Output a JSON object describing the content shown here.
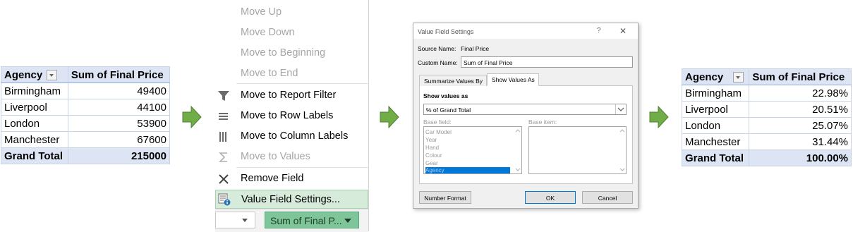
{
  "table1": {
    "header": {
      "agency": "Agency",
      "value": "Sum of Final Price"
    },
    "rows": [
      {
        "agency": "Birmingham",
        "value": "49400"
      },
      {
        "agency": "Liverpool",
        "value": "44100"
      },
      {
        "agency": "London",
        "value": "53900"
      },
      {
        "agency": "Manchester",
        "value": "67600"
      }
    ],
    "total": {
      "label": "Grand Total",
      "value": "215000"
    }
  },
  "arrows": {
    "color": "#70ad47"
  },
  "menu": {
    "items": [
      {
        "label": "Move Up",
        "icon": "none",
        "enabled": false
      },
      {
        "label": "Move Down",
        "icon": "none",
        "enabled": false
      },
      {
        "label": "Move to Beginning",
        "icon": "none",
        "enabled": false
      },
      {
        "label": "Move to End",
        "icon": "none",
        "enabled": false
      },
      {
        "label": "Move to Report Filter",
        "icon": "filter-icon",
        "enabled": true
      },
      {
        "label": "Move to Row Labels",
        "icon": "rows-icon",
        "enabled": true
      },
      {
        "label": "Move to Column Labels",
        "icon": "columns-icon",
        "enabled": true
      },
      {
        "label": "Move to Values",
        "icon": "sigma-icon",
        "enabled": false
      },
      {
        "label": "Remove Field",
        "icon": "close-icon",
        "enabled": true
      },
      {
        "label": "Value Field Settings...",
        "icon": "field-settings-icon",
        "enabled": true,
        "highlighted": true
      }
    ],
    "field_chip": "Sum of Final P..."
  },
  "dialog": {
    "title": "Value Field Settings",
    "help": "?",
    "close": "✕",
    "source_name_label": "Source Name:",
    "source_name_value": "Final Price",
    "custom_name_label": "Custom Name:",
    "custom_name_value": "Sum of Final Price",
    "tabs": [
      "Summarize Values By",
      "Show Values As"
    ],
    "active_tab": "Show Values As",
    "show_values_as_label": "Show values as",
    "show_values_as_value": "% of Grand Total",
    "base_field_label": "Base field:",
    "base_item_label": "Base item:",
    "base_fields": [
      "Car Model",
      "Year",
      "Hand",
      "Colour",
      "Gear",
      "Agency"
    ],
    "number_format_button": "Number Format",
    "ok_button": "OK",
    "cancel_button": "Cancel"
  },
  "table2": {
    "header": {
      "agency": "Agency",
      "value": "Sum of Final Price"
    },
    "rows": [
      {
        "agency": "Birmingham",
        "value": "22.98%"
      },
      {
        "agency": "Liverpool",
        "value": "20.51%"
      },
      {
        "agency": "London",
        "value": "25.07%"
      },
      {
        "agency": "Manchester",
        "value": "31.44%"
      }
    ],
    "total": {
      "label": "Grand Total",
      "value": "100.00%"
    }
  }
}
